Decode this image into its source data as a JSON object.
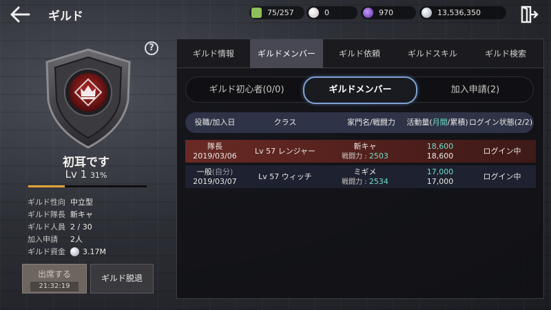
{
  "header": {
    "title": "ギルド",
    "resources": [
      {
        "icon": "stamina-icon",
        "value": "75/257",
        "color": "#8fbf5a"
      },
      {
        "icon": "pearl-icon",
        "value": "0",
        "color": "#e4d9d9"
      },
      {
        "icon": "crystal-icon",
        "value": "970",
        "color": "#8a4fd1"
      },
      {
        "icon": "silver-icon",
        "value": "13,536,350",
        "color": "#c9d0dc"
      }
    ]
  },
  "guild": {
    "name": "初耳です",
    "level": "Lv 1",
    "level_percent": "31%",
    "xp_fraction": 0.31,
    "info": [
      {
        "label": "ギルド性向",
        "value": "中立型"
      },
      {
        "label": "ギルド隊長",
        "value": "新キャ"
      },
      {
        "label": "ギルド人員",
        "value": "2 / 30"
      },
      {
        "label": "加入申請",
        "value": "2人"
      },
      {
        "label": "ギルド資金",
        "value": "3.17M"
      }
    ],
    "attend_label": "出席する",
    "attend_timer": "21:32:19",
    "leave_label": "ギルド脱退"
  },
  "tabs": [
    "ギルド情報",
    "ギルドメンバー",
    "ギルド依頼",
    "ギルドスキル",
    "ギルド検索"
  ],
  "active_tab": 1,
  "subtabs": [
    "ギルド初心者(0/0)",
    "ギルドメンバー",
    "加入申請(2)"
  ],
  "table": {
    "headers": {
      "role": "役職/加入日",
      "class": "クラス",
      "family": "家門名/戦闘力",
      "activity_prefix": "活動量(",
      "activity_monthly": "月間",
      "activity_suffix": "/累積)",
      "login": "ログイン状態(2/2)"
    },
    "power_label": "戦闘力 : ",
    "rows": [
      {
        "role": "隊長",
        "role_note": "",
        "date": "2019/03/06",
        "class": "Lv 57 レンジャー",
        "family": "新キャ",
        "power": "2503",
        "monthly": "18,600",
        "total": "18,600",
        "login": "ログイン中"
      },
      {
        "role": "一般",
        "role_note": "(自分)",
        "date": "2019/03/07",
        "class": "Lv 57 ウィッチ",
        "family": "ミギメ",
        "power": "2534",
        "monthly": "17,000",
        "total": "17,000",
        "login": "ログイン中"
      }
    ]
  }
}
